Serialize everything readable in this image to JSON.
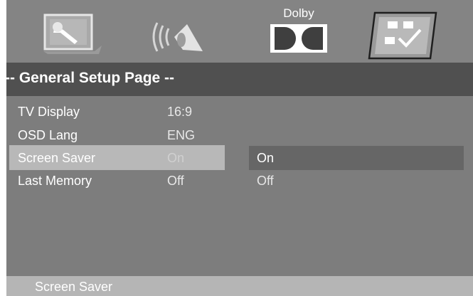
{
  "header": {
    "tabs": [
      {
        "name": "general-setup",
        "icon": "wrench-icon"
      },
      {
        "name": "audio-setup",
        "icon": "speaker-icon"
      },
      {
        "name": "dolby-setup",
        "icon": "dolby-icon",
        "label": "Dolby"
      },
      {
        "name": "preference",
        "icon": "checklist-icon"
      }
    ]
  },
  "page": {
    "title": "-- General Setup Page --"
  },
  "settings": [
    {
      "label": "TV Display",
      "value": "16:9"
    },
    {
      "label": "OSD Lang",
      "value": "ENG"
    },
    {
      "label": "Screen Saver",
      "value": "On"
    },
    {
      "label": "Last Memory",
      "value": "Off"
    }
  ],
  "options": [
    "On",
    "Off"
  ],
  "status": {
    "text": "Screen Saver"
  },
  "colors": {
    "background": "#7d7d7d",
    "title_bar": "#505050",
    "highlight": "#b8b8b8",
    "option_highlight": "#666666",
    "status_bar": "#b5b5b5"
  }
}
